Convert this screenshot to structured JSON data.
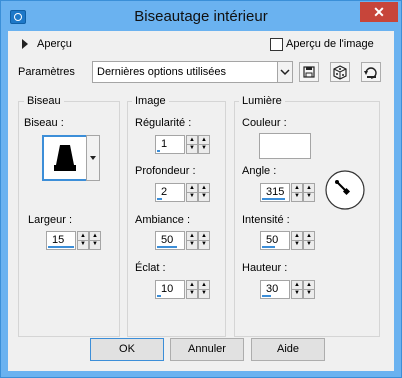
{
  "window": {
    "title": "Biseautage intérieur",
    "close_label": "✕"
  },
  "preview": {
    "toggle_label": "Aperçu",
    "checkbox_label": "Aperçu de l'image",
    "checkbox_checked": false
  },
  "presets": {
    "label": "Paramètres",
    "selected": "Dernières options utilisées"
  },
  "bevel_group": {
    "title": "Biseau",
    "bevel_label": "Biseau :",
    "width_label": "Largeur :",
    "width_value": "15"
  },
  "image_group": {
    "title": "Image",
    "smoothness_label": "Régularité :",
    "smoothness_value": "1",
    "depth_label": "Profondeur :",
    "depth_value": "2",
    "ambience_label": "Ambiance :",
    "ambience_value": "50",
    "shininess_label": "Éclat :",
    "shininess_value": "10"
  },
  "light_group": {
    "title": "Lumière",
    "color_label": "Couleur :",
    "color_value": "#ffffff",
    "angle_label": "Angle :",
    "angle_value": "315",
    "intensity_label": "Intensité :",
    "intensity_value": "50",
    "height_label": "Hauteur :",
    "height_value": "30"
  },
  "buttons": {
    "ok": "OK",
    "cancel": "Annuler",
    "help": "Aide"
  },
  "colors": {
    "title_bar": "#6ab2f0",
    "close_button": "#c7453a",
    "accent": "#3c8ed8"
  },
  "icons": [
    "camera-icon",
    "close-icon",
    "save-preset-icon",
    "randomize-icon",
    "reset-icon",
    "dropdown-arrow-icon",
    "spin-up-icon",
    "spin-down-icon",
    "light-direction-dial-icon"
  ]
}
